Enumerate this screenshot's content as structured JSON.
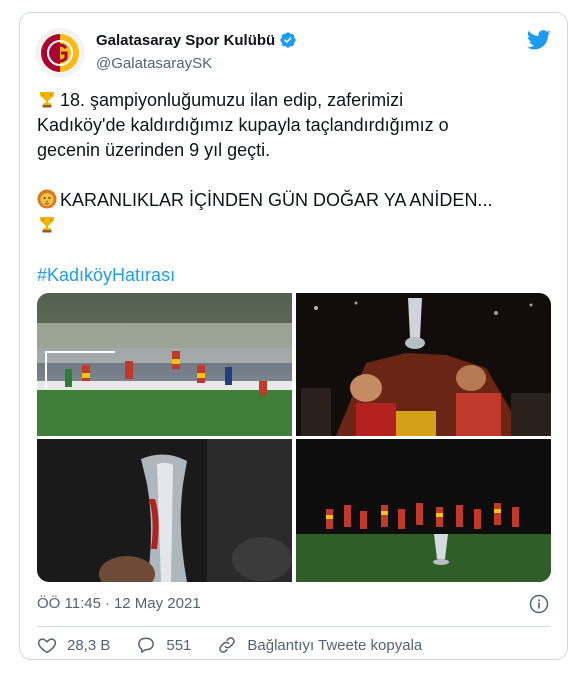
{
  "author": {
    "name": "Galatasaray Spor Kulübü",
    "handle": "@GalatasaraySK",
    "verified": true
  },
  "tweet": {
    "line1": "18. şampiyonluğumuzu ilan edip, zaferimizi",
    "line2": "Kadıköy'de kaldırdığımız kupayla taçlandırdığımız o",
    "line3": "gecenin üzerinden 9 yıl geçti.",
    "line4": "KARANLIKLAR İÇİNDEN GÜN DOĞAR YA ANİDEN...",
    "hashtag": "#KadıköyHatırası"
  },
  "icons": {
    "trophy": "trophy-emoji",
    "lion": "lion-emoji",
    "brand": "twitter-bird-icon"
  },
  "meta": {
    "time": "ÖÖ 11:45",
    "separator": "·",
    "date": "12 May 2021"
  },
  "actions": {
    "likes": "28,3 B",
    "replies": "551",
    "copy_link": "Bağlantıyı Tweete kopyala"
  },
  "colors": {
    "accent": "#1d9bf0",
    "text": "#0f1419",
    "muted": "#536471",
    "border": "#cfd9de",
    "brand_red": "#a90432",
    "brand_yellow": "#fdb912"
  }
}
